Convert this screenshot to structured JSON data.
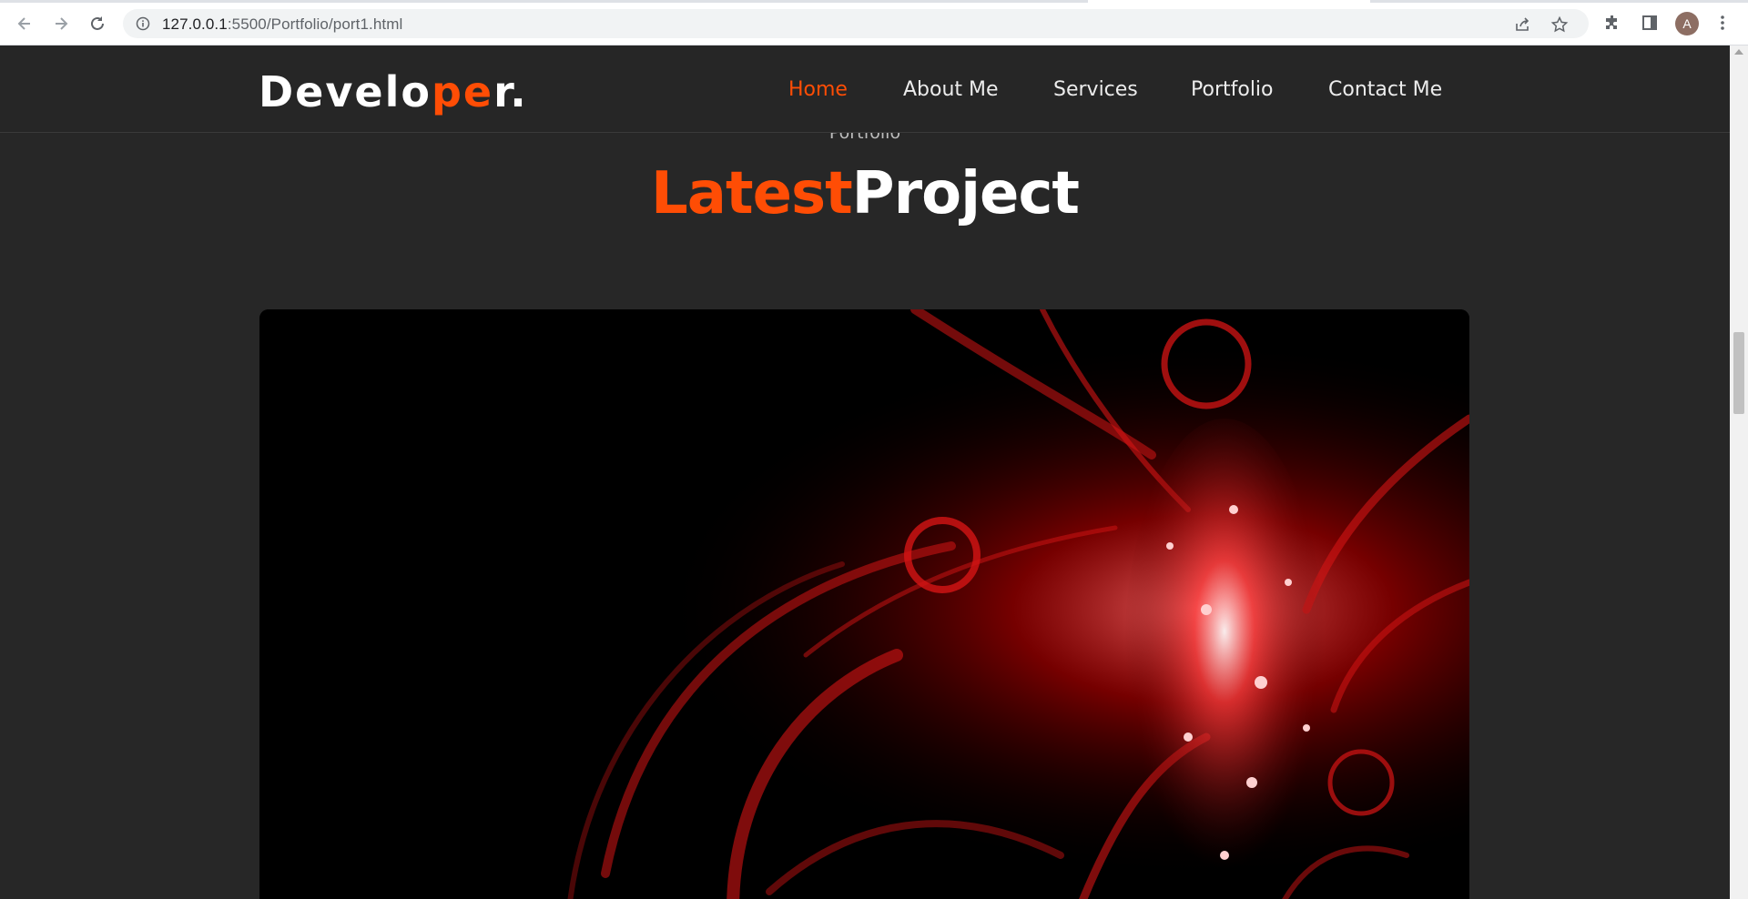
{
  "browser": {
    "url_host": "127.0.0.1",
    "url_path": ":5500/Portfolio/port1.html",
    "profile_initial": "A",
    "icons": [
      "back-icon",
      "forward-icon",
      "reload-icon",
      "info-icon",
      "share-icon",
      "star-icon",
      "extensions-icon",
      "side-panel-icon",
      "menu-icon"
    ]
  },
  "header": {
    "logo_main": "Develo",
    "logo_accent": "pe",
    "logo_end": "r.",
    "nav": [
      {
        "label": "Home",
        "active": true
      },
      {
        "label": "About Me",
        "active": false
      },
      {
        "label": "Services",
        "active": false
      },
      {
        "label": "Portfolio",
        "active": false
      },
      {
        "label": "Contact Me",
        "active": false
      }
    ]
  },
  "section": {
    "subtitle": "Portfolio",
    "title_accent": "Latest",
    "title_rest": "Project"
  },
  "colors": {
    "accent": "#ff4d05",
    "background": "#272727",
    "text": "#ffffff"
  }
}
